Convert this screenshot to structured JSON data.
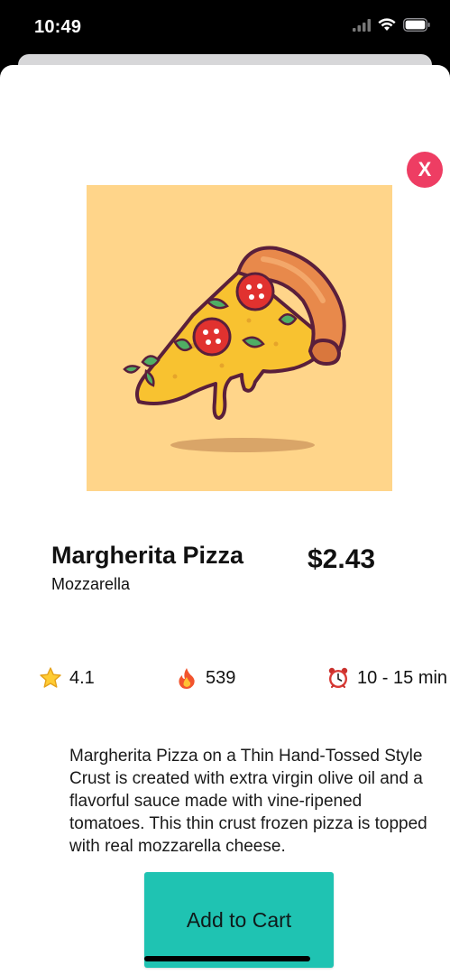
{
  "status_bar": {
    "time": "10:49",
    "icons": [
      "cellular-signal-icon",
      "wifi-icon",
      "battery-icon"
    ]
  },
  "product": {
    "name": "Margherita Pizza",
    "subtitle": "Mozzarella",
    "price": "$2.43",
    "image_icon": "pizza-slice-illustration"
  },
  "stats": {
    "rating": {
      "icon": "star-icon",
      "value": "4.1"
    },
    "calories": {
      "icon": "fire-icon",
      "value": "539"
    },
    "time": {
      "icon": "alarm-clock-icon",
      "value": "10 - 15 min"
    }
  },
  "description": "Margherita  Pizza on a Thin Hand-Tossed Style Crust is created with extra virgin olive oil and a flavorful sauce made with vine-ripened tomatoes. This thin crust frozen pizza is topped with real mozzarella cheese.",
  "close_button": {
    "label": "X"
  },
  "cart_button": {
    "label": "Add to Cart"
  },
  "colors": {
    "sheet_background": "#ffffff",
    "close_button": "#ee3d63",
    "image_background": "#ffd58a",
    "cart_button": "#1fc3b2"
  }
}
